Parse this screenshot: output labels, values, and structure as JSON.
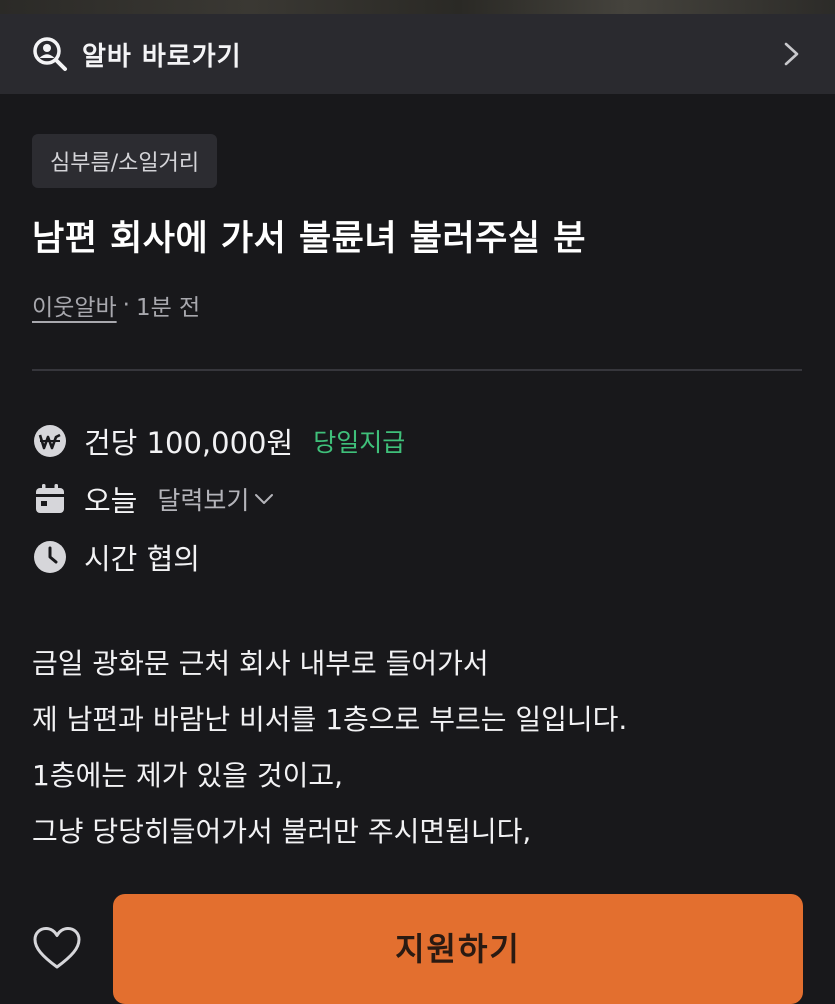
{
  "quick_bar": {
    "icon": "search-person-icon",
    "label": "알바 바로가기",
    "chevron": "chevron-right-icon"
  },
  "post": {
    "category": "심부름/소일거리",
    "title": "남편 회사에 가서 불륜녀 불러주실 분",
    "poster": "이웃알바",
    "separator": "·",
    "time_ago": "1분 전"
  },
  "details": {
    "pay": {
      "icon": "won-icon",
      "text": "건당 100,000원",
      "badge": "당일지급"
    },
    "date": {
      "icon": "calendar-icon",
      "text": "오늘",
      "link": "달력보기"
    },
    "time": {
      "icon": "clock-icon",
      "text": "시간 협의"
    }
  },
  "body": {
    "lines": [
      "금일 광화문 근처 회사 내부로 들어가서",
      "제 남편과 바람난 비서를 1층으로 부르는 일입니다.",
      "1층에는 제가 있을 것이고,",
      "그냥 당당히들어가서 불러만 주시면됩니다,"
    ]
  },
  "actions": {
    "favorite_icon": "heart-icon",
    "apply_label": "지원하기"
  },
  "colors": {
    "background": "#18181b",
    "accent": "#e36f2f",
    "pay_badge": "#3fc07a"
  }
}
